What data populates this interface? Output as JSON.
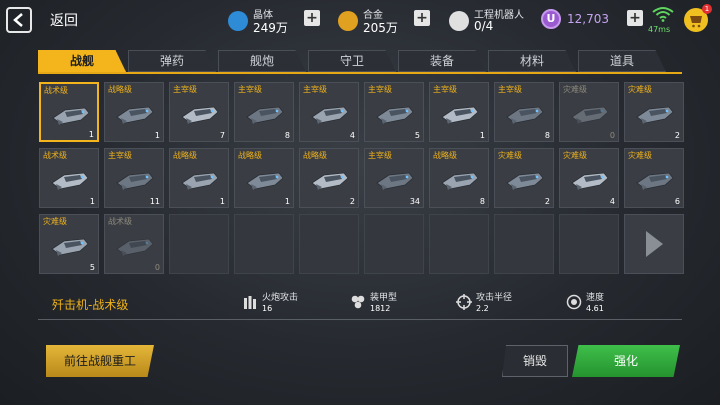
{
  "topbar": {
    "back_label": "返回",
    "resources": [
      {
        "name": "晶体",
        "value": "249万",
        "icon": "crystal-icon",
        "color": "#2e8bd6"
      },
      {
        "name": "合金",
        "value": "205万",
        "icon": "alloy-icon",
        "color": "#e0a020"
      },
      {
        "name": "工程机器人",
        "value": "0/4",
        "icon": "robot-icon",
        "color": "#e0e0e0"
      }
    ],
    "premium": {
      "symbol": "U",
      "value": "12,703",
      "color": "#9a5bd0"
    },
    "ping": "47ms",
    "cart_badge": "1"
  },
  "tabs": [
    "战舰",
    "弹药",
    "舰炮",
    "守卫",
    "装备",
    "材料",
    "道具"
  ],
  "active_tab": 0,
  "cells": [
    {
      "cls": "战术级",
      "count": "1",
      "selected": true
    },
    {
      "cls": "战略级",
      "count": "1"
    },
    {
      "cls": "主宰级",
      "count": "7"
    },
    {
      "cls": "主宰级",
      "count": "8"
    },
    {
      "cls": "主宰级",
      "count": "4"
    },
    {
      "cls": "主宰级",
      "count": "5"
    },
    {
      "cls": "主宰级",
      "count": "1"
    },
    {
      "cls": "主宰级",
      "count": "8"
    },
    {
      "cls": "灾难级",
      "count": "0",
      "dim": true
    },
    {
      "cls": "灾难级",
      "count": "2"
    },
    {
      "cls": "战术级",
      "count": "1"
    },
    {
      "cls": "主宰级",
      "count": "11"
    },
    {
      "cls": "战略级",
      "count": "1"
    },
    {
      "cls": "战略级",
      "count": "1"
    },
    {
      "cls": "战略级",
      "count": "2"
    },
    {
      "cls": "主宰级",
      "count": "34"
    },
    {
      "cls": "战略级",
      "count": "8"
    },
    {
      "cls": "灾难级",
      "count": "2"
    },
    {
      "cls": "灾难级",
      "count": "4"
    },
    {
      "cls": "灾难级",
      "count": "6"
    },
    {
      "cls": "灾难级",
      "count": "5"
    },
    {
      "cls": "战术级",
      "count": "0",
      "dim": true
    }
  ],
  "selected": {
    "name": "歼击机-战术级",
    "stats": [
      {
        "label": "火炮攻击",
        "value": "16",
        "icon": "cannon-icon"
      },
      {
        "label": "装甲型",
        "value": "1812",
        "icon": "armor-icon"
      },
      {
        "label": "攻击半径",
        "value": "2.2",
        "icon": "crosshair-icon"
      },
      {
        "label": "速度",
        "value": "4.61",
        "icon": "speed-icon"
      }
    ]
  },
  "buttons": {
    "goto_forge": "前往战舰重工",
    "destroy": "销毁",
    "upgrade": "强化"
  }
}
